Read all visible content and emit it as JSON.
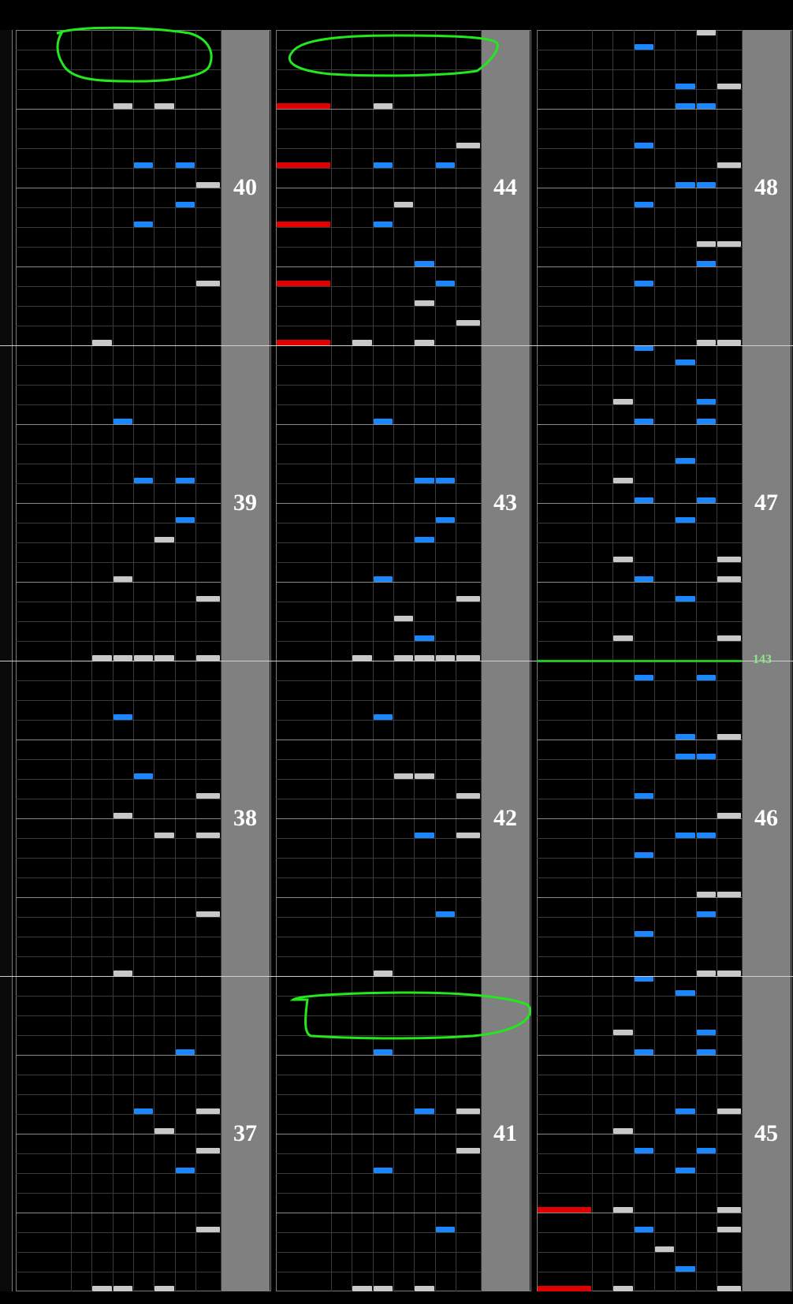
{
  "columns": [
    {
      "measures": [
        {
          "number": "37",
          "notes": [
            {
              "lane": 6,
              "slot": 4,
              "color": "blue"
            },
            {
              "lane": 4,
              "slot": 7,
              "color": "blue"
            },
            {
              "lane": 7,
              "slot": 7,
              "color": "white"
            },
            {
              "lane": 5,
              "slot": 8,
              "color": "white"
            },
            {
              "lane": 7,
              "slot": 9,
              "color": "white"
            },
            {
              "lane": 6,
              "slot": 10,
              "color": "blue"
            },
            {
              "lane": 7,
              "slot": 13,
              "color": "white"
            },
            {
              "lane": 2,
              "slot": 16,
              "color": "white"
            },
            {
              "lane": 3,
              "slot": 16,
              "color": "white"
            },
            {
              "lane": 5,
              "slot": 16,
              "color": "white"
            }
          ]
        },
        {
          "number": "38",
          "notes": [
            {
              "lane": 3,
              "slot": 3,
              "color": "blue"
            },
            {
              "lane": 4,
              "slot": 6,
              "color": "blue"
            },
            {
              "lane": 7,
              "slot": 7,
              "color": "white"
            },
            {
              "lane": 3,
              "slot": 8,
              "color": "white"
            },
            {
              "lane": 5,
              "slot": 9,
              "color": "white"
            },
            {
              "lane": 7,
              "slot": 9,
              "color": "white"
            },
            {
              "lane": 7,
              "slot": 13,
              "color": "white"
            },
            {
              "lane": 3,
              "slot": 16,
              "color": "white"
            }
          ]
        },
        {
          "number": "39",
          "notes": [
            {
              "lane": 3,
              "slot": 4,
              "color": "blue"
            },
            {
              "lane": 4,
              "slot": 7,
              "color": "blue"
            },
            {
              "lane": 6,
              "slot": 7,
              "color": "blue"
            },
            {
              "lane": 6,
              "slot": 9,
              "color": "blue"
            },
            {
              "lane": 5,
              "slot": 10,
              "color": "white"
            },
            {
              "lane": 3,
              "slot": 12,
              "color": "white"
            },
            {
              "lane": 7,
              "slot": 13,
              "color": "white"
            },
            {
              "lane": 2,
              "slot": 16,
              "color": "white"
            },
            {
              "lane": 3,
              "slot": 16,
              "color": "white"
            },
            {
              "lane": 4,
              "slot": 16,
              "color": "white"
            },
            {
              "lane": 5,
              "slot": 16,
              "color": "white"
            },
            {
              "lane": 7,
              "slot": 16,
              "color": "white"
            }
          ]
        },
        {
          "number": "40",
          "notes": [
            {
              "lane": 3,
              "slot": 4,
              "color": "white"
            },
            {
              "lane": 5,
              "slot": 4,
              "color": "white"
            },
            {
              "lane": 4,
              "slot": 7,
              "color": "blue"
            },
            {
              "lane": 6,
              "slot": 7,
              "color": "blue"
            },
            {
              "lane": 7,
              "slot": 8,
              "color": "white"
            },
            {
              "lane": 6,
              "slot": 9,
              "color": "blue"
            },
            {
              "lane": 4,
              "slot": 10,
              "color": "blue"
            },
            {
              "lane": 7,
              "slot": 13,
              "color": "white"
            },
            {
              "lane": 2,
              "slot": 16,
              "color": "white"
            }
          ]
        }
      ]
    },
    {
      "measures": [
        {
          "number": "41",
          "notes": [
            {
              "lane": 3,
              "slot": 4,
              "color": "blue"
            },
            {
              "lane": 5,
              "slot": 7,
              "color": "blue"
            },
            {
              "lane": 7,
              "slot": 7,
              "color": "white"
            },
            {
              "lane": 7,
              "slot": 9,
              "color": "white"
            },
            {
              "lane": 3,
              "slot": 10,
              "color": "blue"
            },
            {
              "lane": 6,
              "slot": 13,
              "color": "blue"
            },
            {
              "lane": 2,
              "slot": 16,
              "color": "white"
            },
            {
              "lane": 3,
              "slot": 16,
              "color": "white"
            },
            {
              "lane": 5,
              "slot": 16,
              "color": "white"
            }
          ]
        },
        {
          "number": "42",
          "notes": [
            {
              "lane": 3,
              "slot": 3,
              "color": "blue"
            },
            {
              "lane": 4,
              "slot": 6,
              "color": "white"
            },
            {
              "lane": 5,
              "slot": 6,
              "color": "white"
            },
            {
              "lane": 7,
              "slot": 7,
              "color": "white"
            },
            {
              "lane": 5,
              "slot": 9,
              "color": "blue"
            },
            {
              "lane": 7,
              "slot": 9,
              "color": "white"
            },
            {
              "lane": 6,
              "slot": 13,
              "color": "blue"
            },
            {
              "lane": 3,
              "slot": 16,
              "color": "white"
            }
          ]
        },
        {
          "number": "43",
          "notes": [
            {
              "lane": 3,
              "slot": 4,
              "color": "blue"
            },
            {
              "lane": 5,
              "slot": 7,
              "color": "blue"
            },
            {
              "lane": 6,
              "slot": 7,
              "color": "blue"
            },
            {
              "lane": 6,
              "slot": 9,
              "color": "blue"
            },
            {
              "lane": 5,
              "slot": 10,
              "color": "blue"
            },
            {
              "lane": 3,
              "slot": 12,
              "color": "blue"
            },
            {
              "lane": 7,
              "slot": 13,
              "color": "white"
            },
            {
              "lane": 4,
              "slot": 14,
              "color": "white"
            },
            {
              "lane": 5,
              "slot": 15,
              "color": "blue"
            },
            {
              "lane": 2,
              "slot": 16,
              "color": "white"
            },
            {
              "lane": 4,
              "slot": 16,
              "color": "white"
            },
            {
              "lane": 5,
              "slot": 16,
              "color": "white"
            },
            {
              "lane": 6,
              "slot": 16,
              "color": "white"
            },
            {
              "lane": 7,
              "slot": 16,
              "color": "white"
            }
          ]
        },
        {
          "number": "44",
          "notes": [
            {
              "lane": 0,
              "slot": 4,
              "color": "red"
            },
            {
              "lane": 3,
              "slot": 4,
              "color": "white"
            },
            {
              "lane": 7,
              "slot": 6,
              "color": "white"
            },
            {
              "lane": 0,
              "slot": 7,
              "color": "red"
            },
            {
              "lane": 3,
              "slot": 7,
              "color": "blue"
            },
            {
              "lane": 6,
              "slot": 7,
              "color": "blue"
            },
            {
              "lane": 4,
              "slot": 9,
              "color": "white"
            },
            {
              "lane": 0,
              "slot": 10,
              "color": "red"
            },
            {
              "lane": 3,
              "slot": 10,
              "color": "blue"
            },
            {
              "lane": 5,
              "slot": 12,
              "color": "blue"
            },
            {
              "lane": 0,
              "slot": 13,
              "color": "red"
            },
            {
              "lane": 6,
              "slot": 13,
              "color": "blue"
            },
            {
              "lane": 5,
              "slot": 14,
              "color": "white"
            },
            {
              "lane": 7,
              "slot": 15,
              "color": "white"
            },
            {
              "lane": 0,
              "slot": 16,
              "color": "red"
            },
            {
              "lane": 2,
              "slot": 16,
              "color": "white"
            },
            {
              "lane": 5,
              "slot": 16,
              "color": "white"
            }
          ]
        }
      ]
    },
    {
      "measures": [
        {
          "number": "45",
          "notes": [
            {
              "lane": 3,
              "slot": 0,
              "color": "blue"
            },
            {
              "lane": 5,
              "slot": 1,
              "color": "blue"
            },
            {
              "lane": 2,
              "slot": 3,
              "color": "white"
            },
            {
              "lane": 6,
              "slot": 3,
              "color": "blue"
            },
            {
              "lane": 3,
              "slot": 4,
              "color": "blue"
            },
            {
              "lane": 6,
              "slot": 4,
              "color": "blue"
            },
            {
              "lane": 5,
              "slot": 7,
              "color": "blue"
            },
            {
              "lane": 7,
              "slot": 7,
              "color": "white"
            },
            {
              "lane": 2,
              "slot": 8,
              "color": "white"
            },
            {
              "lane": 3,
              "slot": 9,
              "color": "blue"
            },
            {
              "lane": 6,
              "slot": 9,
              "color": "blue"
            },
            {
              "lane": 5,
              "slot": 10,
              "color": "blue"
            },
            {
              "lane": 0,
              "slot": 12,
              "color": "red"
            },
            {
              "lane": 2,
              "slot": 12,
              "color": "white"
            },
            {
              "lane": 7,
              "slot": 12,
              "color": "white"
            },
            {
              "lane": 3,
              "slot": 13,
              "color": "blue"
            },
            {
              "lane": 7,
              "slot": 13,
              "color": "white"
            },
            {
              "lane": 4,
              "slot": 14,
              "color": "white"
            },
            {
              "lane": 5,
              "slot": 15,
              "color": "blue"
            },
            {
              "lane": 0,
              "slot": 16,
              "color": "red"
            },
            {
              "lane": 2,
              "slot": 16,
              "color": "white"
            },
            {
              "lane": 7,
              "slot": 16,
              "color": "white"
            }
          ]
        },
        {
          "number": "46",
          "notes": [
            {
              "lane": 3,
              "slot": 1,
              "color": "blue"
            },
            {
              "lane": 6,
              "slot": 1,
              "color": "blue"
            },
            {
              "lane": 5,
              "slot": 4,
              "color": "blue"
            },
            {
              "lane": 7,
              "slot": 4,
              "color": "white"
            },
            {
              "lane": 5,
              "slot": 5,
              "color": "blue"
            },
            {
              "lane": 6,
              "slot": 5,
              "color": "blue"
            },
            {
              "lane": 3,
              "slot": 7,
              "color": "blue"
            },
            {
              "lane": 7,
              "slot": 8,
              "color": "white"
            },
            {
              "lane": 5,
              "slot": 9,
              "color": "blue"
            },
            {
              "lane": 6,
              "slot": 9,
              "color": "blue"
            },
            {
              "lane": 3,
              "slot": 10,
              "color": "blue"
            },
            {
              "lane": 6,
              "slot": 12,
              "color": "white"
            },
            {
              "lane": 7,
              "slot": 12,
              "color": "white"
            },
            {
              "lane": 6,
              "slot": 13,
              "color": "white"
            },
            {
              "lane": 6,
              "slot": 13,
              "color": "blue"
            },
            {
              "lane": 3,
              "slot": 14,
              "color": "blue"
            },
            {
              "lane": 6,
              "slot": 16,
              "color": "white"
            },
            {
              "lane": 7,
              "slot": 16,
              "color": "white"
            }
          ]
        },
        {
          "number": "47",
          "bpm": "143",
          "notes": [
            {
              "lane": 3,
              "slot": 0,
              "color": "blue"
            },
            {
              "lane": 5,
              "slot": 1,
              "color": "blue"
            },
            {
              "lane": 2,
              "slot": 3,
              "color": "white"
            },
            {
              "lane": 6,
              "slot": 3,
              "color": "blue"
            },
            {
              "lane": 3,
              "slot": 4,
              "color": "blue"
            },
            {
              "lane": 6,
              "slot": 4,
              "color": "blue"
            },
            {
              "lane": 5,
              "slot": 6,
              "color": "blue"
            },
            {
              "lane": 2,
              "slot": 7,
              "color": "white"
            },
            {
              "lane": 3,
              "slot": 8,
              "color": "blue"
            },
            {
              "lane": 6,
              "slot": 8,
              "color": "blue"
            },
            {
              "lane": 5,
              "slot": 9,
              "color": "blue"
            },
            {
              "lane": 2,
              "slot": 11,
              "color": "white"
            },
            {
              "lane": 7,
              "slot": 11,
              "color": "white"
            },
            {
              "lane": 3,
              "slot": 12,
              "color": "blue"
            },
            {
              "lane": 7,
              "slot": 12,
              "color": "white"
            },
            {
              "lane": 5,
              "slot": 13,
              "color": "blue"
            },
            {
              "lane": 2,
              "slot": 15,
              "color": "white"
            },
            {
              "lane": 7,
              "slot": 15,
              "color": "white"
            }
          ]
        },
        {
          "number": "48",
          "notes": [
            {
              "lane": 6,
              "slot": 0,
              "color": "white"
            },
            {
              "lane": 3,
              "slot": 1,
              "color": "blue"
            },
            {
              "lane": 5,
              "slot": 3,
              "color": "blue"
            },
            {
              "lane": 7,
              "slot": 3,
              "color": "white"
            },
            {
              "lane": 5,
              "slot": 4,
              "color": "blue"
            },
            {
              "lane": 6,
              "slot": 4,
              "color": "blue"
            },
            {
              "lane": 3,
              "slot": 6,
              "color": "blue"
            },
            {
              "lane": 7,
              "slot": 7,
              "color": "white"
            },
            {
              "lane": 5,
              "slot": 8,
              "color": "blue"
            },
            {
              "lane": 6,
              "slot": 8,
              "color": "blue"
            },
            {
              "lane": 3,
              "slot": 9,
              "color": "blue"
            },
            {
              "lane": 6,
              "slot": 11,
              "color": "white"
            },
            {
              "lane": 7,
              "slot": 11,
              "color": "white"
            },
            {
              "lane": 6,
              "slot": 12,
              "color": "white"
            },
            {
              "lane": 6,
              "slot": 12,
              "color": "blue"
            },
            {
              "lane": 3,
              "slot": 13,
              "color": "blue"
            },
            {
              "lane": 6,
              "slot": 16,
              "color": "white"
            },
            {
              "lane": 7,
              "slot": 16,
              "color": "white"
            }
          ]
        }
      ]
    }
  ],
  "colors": {
    "blue": "#1a86ff",
    "white": "#c8c8c8",
    "red": "#e00000",
    "bpm": "#22c31f",
    "annotation": "#22e81d"
  }
}
